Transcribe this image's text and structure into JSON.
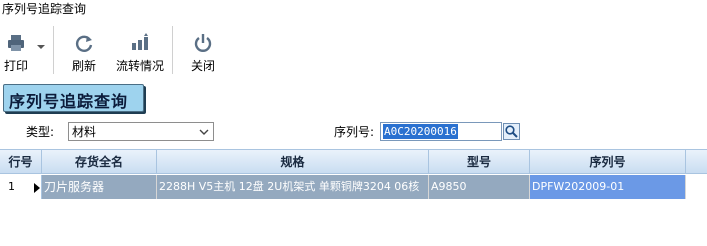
{
  "window": {
    "title": "序列号追踪查询"
  },
  "toolbar": {
    "print_label": "打印",
    "refresh_label": "刷新",
    "flow_label": "流转情况",
    "close_label": "关闭"
  },
  "section": {
    "title": "序列号追踪查询"
  },
  "filters": {
    "type_label": "类型:",
    "type_value": "材料",
    "serial_label": "序列号:",
    "serial_value": "A0C20200016"
  },
  "grid": {
    "columns": [
      "行号",
      "存货全名",
      "规格",
      "型号",
      "序列号"
    ],
    "rows": [
      {
        "row_no": "1",
        "name": "刀片服务器",
        "spec": "2288H V5主机 12盘 2U机架式 单颗铜牌3204 06核",
        "model": "A9850",
        "serial": "DPFW202009-01"
      }
    ]
  },
  "colors": {
    "section_bg": "#9ed3ee",
    "header_bg": "#c9ddf1",
    "selected_row": "#94a9bf",
    "focused_cell": "#6b99e6",
    "input_highlight": "#2a71d0"
  }
}
